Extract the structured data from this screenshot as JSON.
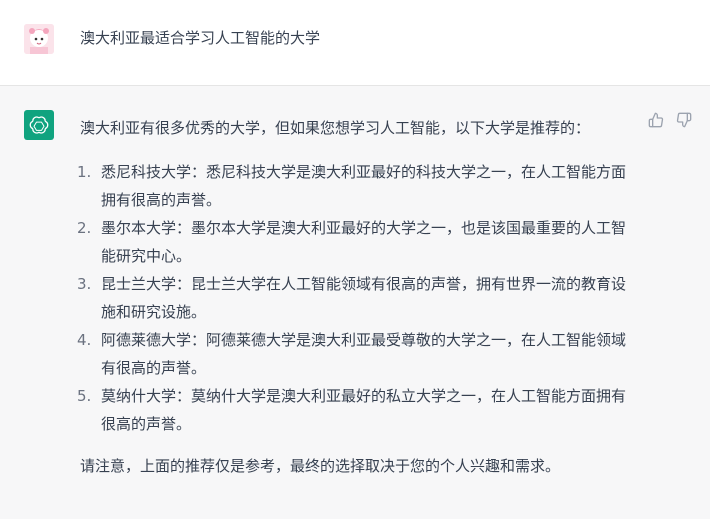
{
  "user_message": {
    "avatar_icon": "user-avatar-icon",
    "text": "澳大利亚最适合学习人工智能的大学"
  },
  "assistant_message": {
    "avatar_icon": "openai-logo-icon",
    "accent_color": "#10a37f",
    "intro": "澳大利亚有很多优秀的大学，但如果您想学习人工智能，以下大学是推荐的：",
    "items": [
      {
        "num": "1.",
        "text": "悉尼科技大学：悉尼科技大学是澳大利亚最好的科技大学之一，在人工智能方面拥有很高的声誉。"
      },
      {
        "num": "2.",
        "text": "墨尔本大学：墨尔本大学是澳大利亚最好的大学之一，也是该国最重要的人工智能研究中心。"
      },
      {
        "num": "3.",
        "text": "昆士兰大学：昆士兰大学在人工智能领域有很高的声誉，拥有世界一流的教育设施和研究设施。"
      },
      {
        "num": "4.",
        "text": "阿德莱德大学：阿德莱德大学是澳大利亚最受尊敬的大学之一，在人工智能领域有很高的声誉。"
      },
      {
        "num": "5.",
        "text": "莫纳什大学：莫纳什大学是澳大利亚最好的私立大学之一，在人工智能方面拥有很高的声誉。"
      }
    ],
    "note": "请注意，上面的推荐仅是参考，最终的选择取决于您的个人兴趣和需求。",
    "actions": [
      "thumbs-up-icon",
      "thumbs-down-icon"
    ]
  }
}
